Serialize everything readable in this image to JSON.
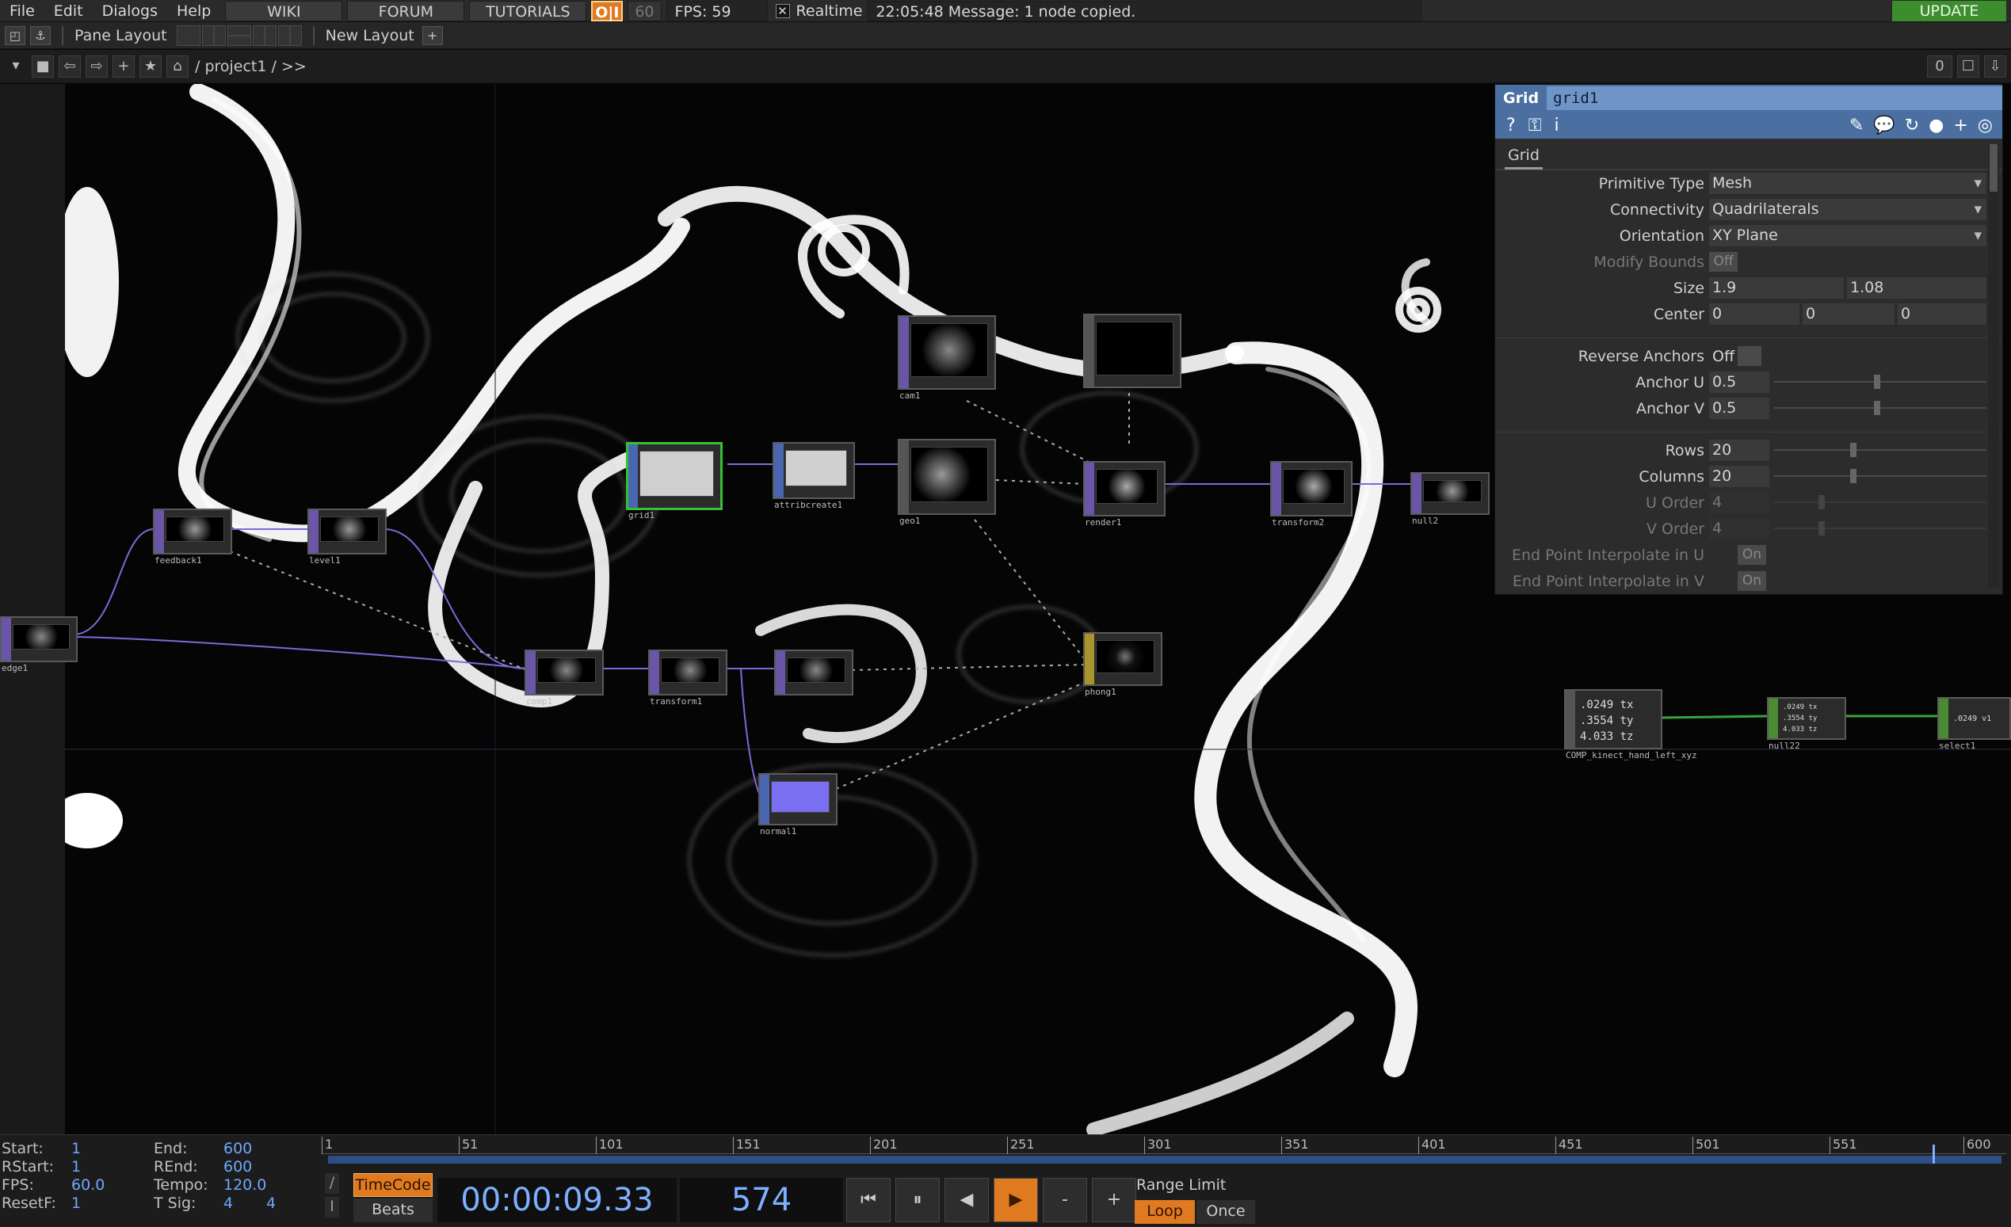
{
  "menu": {
    "items": [
      "File",
      "Edit",
      "Dialogs",
      "Help"
    ],
    "wiki": "WIKI",
    "forum": "FORUM",
    "tutorials": "TUTORIALS",
    "oi": "O|I",
    "fps_target": "60",
    "fps_label": "FPS:  59",
    "realtime_check": "✕",
    "realtime": "Realtime",
    "message": "22:05:48 Message: 1 node copied.",
    "update": "UPDATE"
  },
  "panebar": {
    "pane_layout": "Pane Layout",
    "new_layout": "New Layout",
    "add": "+"
  },
  "pathbar": {
    "path": "/ project1 / >>",
    "counter": "0"
  },
  "nodes": {
    "cam1": "cam1",
    "geo1": "geo1",
    "grid1": "grid1",
    "attribcreate1": "attribcreate1",
    "render1": "render1",
    "transform2": "transform2",
    "null2": "null2",
    "feedback1": "feedback1",
    "level1": "level1",
    "edge1": "edge1",
    "comp1": "comp1",
    "transform1": "transform1",
    "phong1": "phong1",
    "normal1": "normal1",
    "comp_kinect": "COMP_kinect_hand_left_xyz",
    "null22": "null22",
    "select1": "select1",
    "kinect_vals": [
      ".0249 tx",
      ".3554 ty",
      "4.033 tz"
    ],
    "null22_vals": [
      ".0249 tx",
      ".3554 ty",
      "4.033 tz"
    ],
    "select1_val": ".0249 v1"
  },
  "params": {
    "type": "Grid",
    "name": "grid1",
    "tab": "Grid",
    "primitive_type_label": "Primitive Type",
    "primitive_type": "Mesh",
    "connectivity_label": "Connectivity",
    "connectivity": "Quadrilaterals",
    "orientation_label": "Orientation",
    "orientation": "XY Plane",
    "modify_bounds_label": "Modify Bounds",
    "modify_bounds": "Off",
    "size_label": "Size",
    "size_x": "1.9",
    "size_y": "1.08",
    "center_label": "Center",
    "center_x": "0",
    "center_y": "0",
    "center_z": "0",
    "reverse_anchors_label": "Reverse Anchors",
    "reverse_anchors": "Off",
    "anchor_u_label": "Anchor U",
    "anchor_u": "0.5",
    "anchor_v_label": "Anchor V",
    "anchor_v": "0.5",
    "rows_label": "Rows",
    "rows": "20",
    "columns_label": "Columns",
    "columns": "20",
    "u_order_label": "U Order",
    "u_order": "4",
    "v_order_label": "V Order",
    "v_order": "4",
    "epu_label": "End Point Interpolate in U",
    "epu": "On",
    "epv_label": "End Point Interpolate in V",
    "epv": "On"
  },
  "timeline": {
    "start_label": "Start:",
    "start": "1",
    "end_label": "End:",
    "end": "600",
    "rstart_label": "RStart:",
    "rstart": "1",
    "rend_label": "REnd:",
    "rend": "600",
    "fps_label": "FPS:",
    "fps": "60.0",
    "tempo_label": "Tempo:",
    "tempo": "120.0",
    "resetf_label": "ResetF:",
    "resetf": "1",
    "tsig_label": "T Sig:",
    "tsig_a": "4",
    "tsig_b": "4",
    "ticks": [
      "1",
      "51",
      "101",
      "151",
      "201",
      "251",
      "301",
      "351",
      "401",
      "451",
      "501",
      "551",
      "600"
    ],
    "timecode_btn": "TimeCode",
    "beats_btn": "Beats",
    "timecode": "00:00:09.33",
    "frame": "574",
    "minus": "-",
    "plus": "+",
    "range_limit": "Range Limit",
    "loop": "Loop",
    "once": "Once"
  },
  "colors": {
    "accent_orange": "#e07a20",
    "update_green": "#3c8d2e",
    "param_header": "#4a6fa0",
    "timecode_blue": "#7db0ff",
    "select_green": "#35c035"
  }
}
